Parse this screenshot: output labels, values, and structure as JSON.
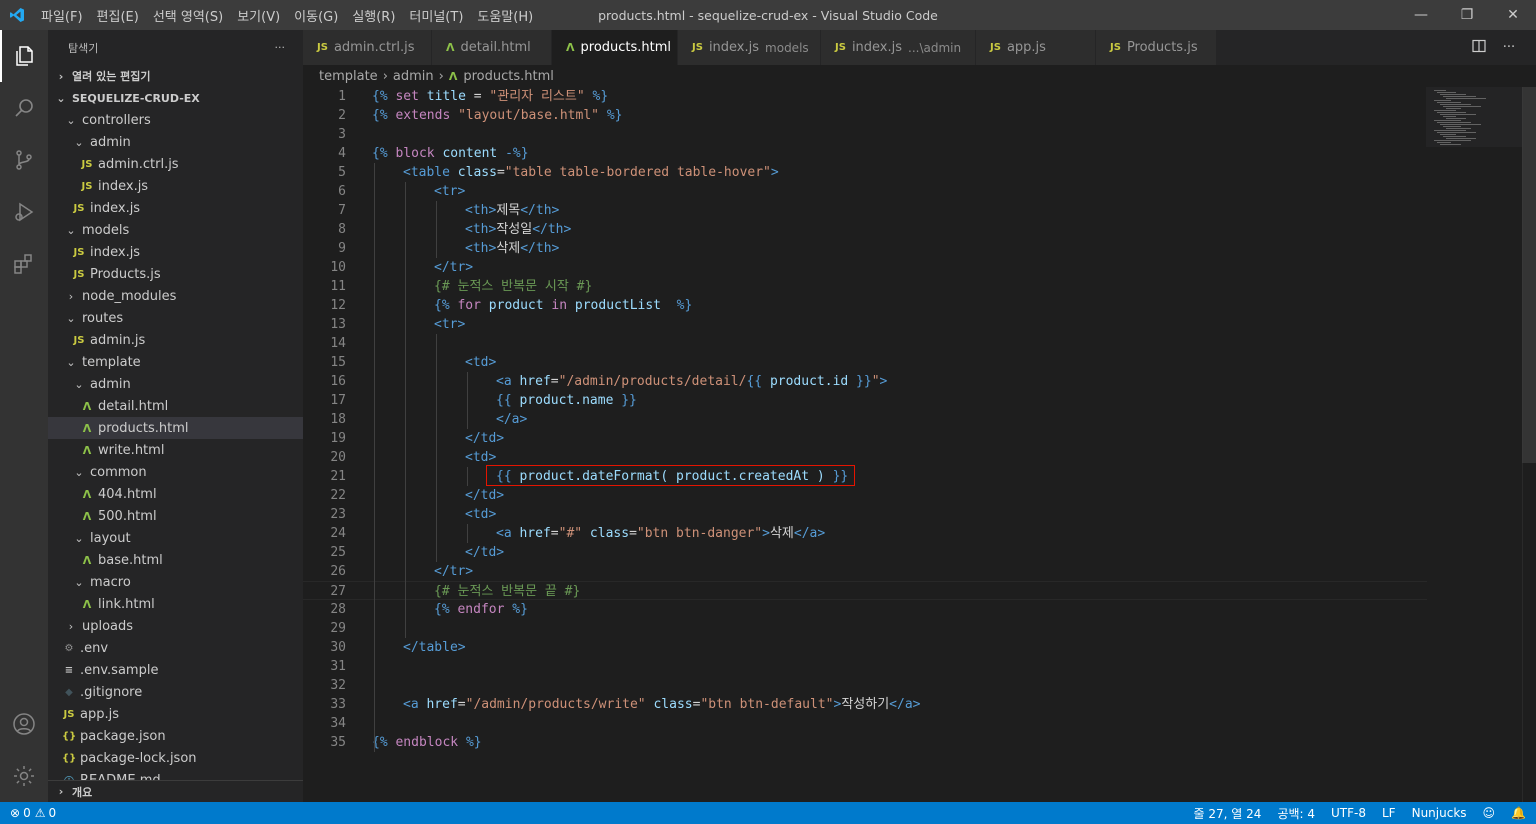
{
  "window": {
    "title": "products.html - sequelize-crud-ex - Visual Studio Code",
    "menu": [
      "파일(F)",
      "편집(E)",
      "선택 영역(S)",
      "보기(V)",
      "이동(G)",
      "실행(R)",
      "터미널(T)",
      "도움말(H)"
    ]
  },
  "sidebar": {
    "header": "탐색기",
    "more": "···",
    "open_editors": "열려 있는 편집기",
    "project": "SEQUELIZE-CRUD-EX",
    "tree": [
      {
        "label": "controllers",
        "kind": "folder-open",
        "depth": 1
      },
      {
        "label": "admin",
        "kind": "folder-open",
        "depth": 2
      },
      {
        "label": "admin.ctrl.js",
        "kind": "js",
        "depth": 3
      },
      {
        "label": "index.js",
        "kind": "js",
        "depth": 3
      },
      {
        "label": "index.js",
        "kind": "js",
        "depth": 2
      },
      {
        "label": "models",
        "kind": "folder-open",
        "depth": 1
      },
      {
        "label": "index.js",
        "kind": "js",
        "depth": 2
      },
      {
        "label": "Products.js",
        "kind": "js",
        "depth": 2
      },
      {
        "label": "node_modules",
        "kind": "folder-closed",
        "depth": 1
      },
      {
        "label": "routes",
        "kind": "folder-open",
        "depth": 1
      },
      {
        "label": "admin.js",
        "kind": "js",
        "depth": 2
      },
      {
        "label": "template",
        "kind": "folder-open",
        "depth": 1
      },
      {
        "label": "admin",
        "kind": "folder-open",
        "depth": 2
      },
      {
        "label": "detail.html",
        "kind": "html",
        "depth": 3
      },
      {
        "label": "products.html",
        "kind": "html",
        "depth": 3,
        "selected": true
      },
      {
        "label": "write.html",
        "kind": "html",
        "depth": 3
      },
      {
        "label": "common",
        "kind": "folder-open",
        "depth": 2
      },
      {
        "label": "404.html",
        "kind": "html",
        "depth": 3
      },
      {
        "label": "500.html",
        "kind": "html",
        "depth": 3
      },
      {
        "label": "layout",
        "kind": "folder-open",
        "depth": 2
      },
      {
        "label": "base.html",
        "kind": "html",
        "depth": 3
      },
      {
        "label": "macro",
        "kind": "folder-open",
        "depth": 2
      },
      {
        "label": "link.html",
        "kind": "html",
        "depth": 3
      },
      {
        "label": "uploads",
        "kind": "folder-closed",
        "depth": 1
      },
      {
        "label": ".env",
        "kind": "gear",
        "depth": 1
      },
      {
        "label": ".env.sample",
        "kind": "lines",
        "depth": 1
      },
      {
        "label": ".gitignore",
        "kind": "git",
        "depth": 1
      },
      {
        "label": "app.js",
        "kind": "js",
        "depth": 1
      },
      {
        "label": "package.json",
        "kind": "json",
        "depth": 1
      },
      {
        "label": "package-lock.json",
        "kind": "json",
        "depth": 1
      },
      {
        "label": "README.md",
        "kind": "info",
        "depth": 1
      }
    ],
    "outline": "개요"
  },
  "tabs": [
    {
      "label": "admin.ctrl.js",
      "kind": "js",
      "desc": ""
    },
    {
      "label": "detail.html",
      "kind": "html",
      "desc": ""
    },
    {
      "label": "products.html",
      "kind": "html",
      "desc": "",
      "active": true
    },
    {
      "label": "index.js",
      "kind": "js",
      "desc": "models"
    },
    {
      "label": "index.js",
      "kind": "js",
      "desc": "...\\admin"
    },
    {
      "label": "app.js",
      "kind": "js",
      "desc": ""
    },
    {
      "label": "Products.js",
      "kind": "js",
      "desc": ""
    }
  ],
  "breadcrumb": [
    "template",
    "admin",
    "products.html"
  ],
  "editor": {
    "current_line": 27,
    "highlighted_line": 21,
    "lines": [
      {
        "n": "1",
        "indent": 0,
        "tokens": [
          [
            "nj",
            "{%"
          ],
          [
            "kw",
            " set "
          ],
          [
            "var",
            "title"
          ],
          [
            "txt",
            " = "
          ],
          [
            "str",
            "\"관리자 리스트\""
          ],
          [
            "nj",
            " %}"
          ]
        ]
      },
      {
        "n": "2",
        "indent": 0,
        "tokens": [
          [
            "nj",
            "{%"
          ],
          [
            "kw",
            " extends "
          ],
          [
            "str",
            "\"layout/base.html\""
          ],
          [
            "nj",
            " %}"
          ]
        ]
      },
      {
        "n": "3",
        "indent": 0,
        "tokens": []
      },
      {
        "n": "4",
        "indent": 0,
        "tokens": [
          [
            "nj",
            "{%"
          ],
          [
            "kw",
            " block "
          ],
          [
            "var",
            "content"
          ],
          [
            "nj",
            " -%}"
          ]
        ]
      },
      {
        "n": "5",
        "indent": 1,
        "tokens": [
          [
            "tag",
            "<table"
          ],
          [
            "attr",
            " class"
          ],
          [
            "txt",
            "="
          ],
          [
            "str",
            "\"table table-bordered table-hover\""
          ],
          [
            "tag",
            ">"
          ]
        ]
      },
      {
        "n": "6",
        "indent": 2,
        "tokens": [
          [
            "tag",
            "<tr>"
          ]
        ]
      },
      {
        "n": "7",
        "indent": 3,
        "tokens": [
          [
            "tag",
            "<th>"
          ],
          [
            "txt",
            "제목"
          ],
          [
            "tag",
            "</th>"
          ]
        ]
      },
      {
        "n": "8",
        "indent": 3,
        "tokens": [
          [
            "tag",
            "<th>"
          ],
          [
            "txt",
            "작성일"
          ],
          [
            "tag",
            "</th>"
          ]
        ]
      },
      {
        "n": "9",
        "indent": 3,
        "tokens": [
          [
            "tag",
            "<th>"
          ],
          [
            "txt",
            "삭제"
          ],
          [
            "tag",
            "</th>"
          ]
        ]
      },
      {
        "n": "10",
        "indent": 2,
        "tokens": [
          [
            "tag",
            "</tr>"
          ]
        ]
      },
      {
        "n": "11",
        "indent": 2,
        "tokens": [
          [
            "cmt",
            "{# 눈적스 반복문 시작 #}"
          ]
        ]
      },
      {
        "n": "12",
        "indent": 2,
        "tokens": [
          [
            "nj",
            "{%"
          ],
          [
            "kw",
            " for "
          ],
          [
            "var",
            "product"
          ],
          [
            "kw",
            " in "
          ],
          [
            "var",
            "productList"
          ],
          [
            "nj",
            "  %}"
          ]
        ]
      },
      {
        "n": "13",
        "indent": 2,
        "tokens": [
          [
            "tag",
            "<tr>"
          ]
        ]
      },
      {
        "n": "14",
        "indent": 0,
        "tokens": []
      },
      {
        "n": "15",
        "indent": 3,
        "tokens": [
          [
            "tag",
            "<td>"
          ]
        ]
      },
      {
        "n": "16",
        "indent": 4,
        "tokens": [
          [
            "tag",
            "<a"
          ],
          [
            "attr",
            " href"
          ],
          [
            "txt",
            "="
          ],
          [
            "str",
            "\"/admin/products/detail/"
          ],
          [
            "nj",
            "{{"
          ],
          [
            "var",
            " product.id "
          ],
          [
            "nj",
            "}}"
          ],
          [
            "str",
            "\""
          ],
          [
            "tag",
            ">"
          ]
        ]
      },
      {
        "n": "17",
        "indent": 4,
        "tokens": [
          [
            "nj",
            "{{"
          ],
          [
            "var",
            " product.name "
          ],
          [
            "nj",
            "}}"
          ]
        ]
      },
      {
        "n": "18",
        "indent": 4,
        "tokens": [
          [
            "tag",
            "</a>"
          ]
        ]
      },
      {
        "n": "19",
        "indent": 3,
        "tokens": [
          [
            "tag",
            "</td>"
          ]
        ]
      },
      {
        "n": "20",
        "indent": 3,
        "tokens": [
          [
            "tag",
            "<td>"
          ]
        ]
      },
      {
        "n": "21",
        "indent": 4,
        "tokens": [
          [
            "nj",
            "{{"
          ],
          [
            "var",
            " product.dateFormat( product.createdAt ) "
          ],
          [
            "nj",
            "}}"
          ]
        ]
      },
      {
        "n": "22",
        "indent": 3,
        "tokens": [
          [
            "tag",
            "</td>"
          ]
        ]
      },
      {
        "n": "23",
        "indent": 3,
        "tokens": [
          [
            "tag",
            "<td>"
          ]
        ]
      },
      {
        "n": "24",
        "indent": 4,
        "tokens": [
          [
            "tag",
            "<a"
          ],
          [
            "attr",
            " href"
          ],
          [
            "txt",
            "="
          ],
          [
            "str",
            "\"#\""
          ],
          [
            "attr",
            " class"
          ],
          [
            "txt",
            "="
          ],
          [
            "str",
            "\"btn btn-danger\""
          ],
          [
            "tag",
            ">"
          ],
          [
            "txt",
            "삭제"
          ],
          [
            "tag",
            "</a>"
          ]
        ]
      },
      {
        "n": "25",
        "indent": 3,
        "tokens": [
          [
            "tag",
            "</td>"
          ]
        ]
      },
      {
        "n": "26",
        "indent": 2,
        "tokens": [
          [
            "tag",
            "</tr>"
          ]
        ]
      },
      {
        "n": "27",
        "indent": 2,
        "tokens": [
          [
            "cmt",
            "{# 눈적스 반복문 끝 #}"
          ]
        ]
      },
      {
        "n": "28",
        "indent": 2,
        "tokens": [
          [
            "nj",
            "{%"
          ],
          [
            "kw",
            " endfor "
          ],
          [
            "nj",
            "%}"
          ]
        ]
      },
      {
        "n": "29",
        "indent": 0,
        "tokens": []
      },
      {
        "n": "30",
        "indent": 1,
        "tokens": [
          [
            "tag",
            "</table>"
          ]
        ]
      },
      {
        "n": "31",
        "indent": 0,
        "tokens": []
      },
      {
        "n": "32",
        "indent": 0,
        "tokens": []
      },
      {
        "n": "33",
        "indent": 1,
        "tokens": [
          [
            "tag",
            "<a"
          ],
          [
            "attr",
            " href"
          ],
          [
            "txt",
            "="
          ],
          [
            "str",
            "\"/admin/products/write\""
          ],
          [
            "attr",
            " class"
          ],
          [
            "txt",
            "="
          ],
          [
            "str",
            "\"btn btn-default\""
          ],
          [
            "tag",
            ">"
          ],
          [
            "txt",
            "작성하기"
          ],
          [
            "tag",
            "</a>"
          ]
        ]
      },
      {
        "n": "34",
        "indent": 0,
        "tokens": []
      },
      {
        "n": "35",
        "indent": 0,
        "tokens": [
          [
            "nj",
            "{%"
          ],
          [
            "kw",
            " endblock "
          ],
          [
            "nj",
            "%}"
          ]
        ]
      }
    ]
  },
  "statusbar": {
    "errors": "0",
    "warnings": "0",
    "position": "줄 27, 열 24",
    "spaces": "공백: 4",
    "encoding": "UTF-8",
    "eol": "LF",
    "language": "Nunjucks"
  },
  "colors": {
    "accent": "#007acc",
    "highlight_box": "#e51400"
  }
}
